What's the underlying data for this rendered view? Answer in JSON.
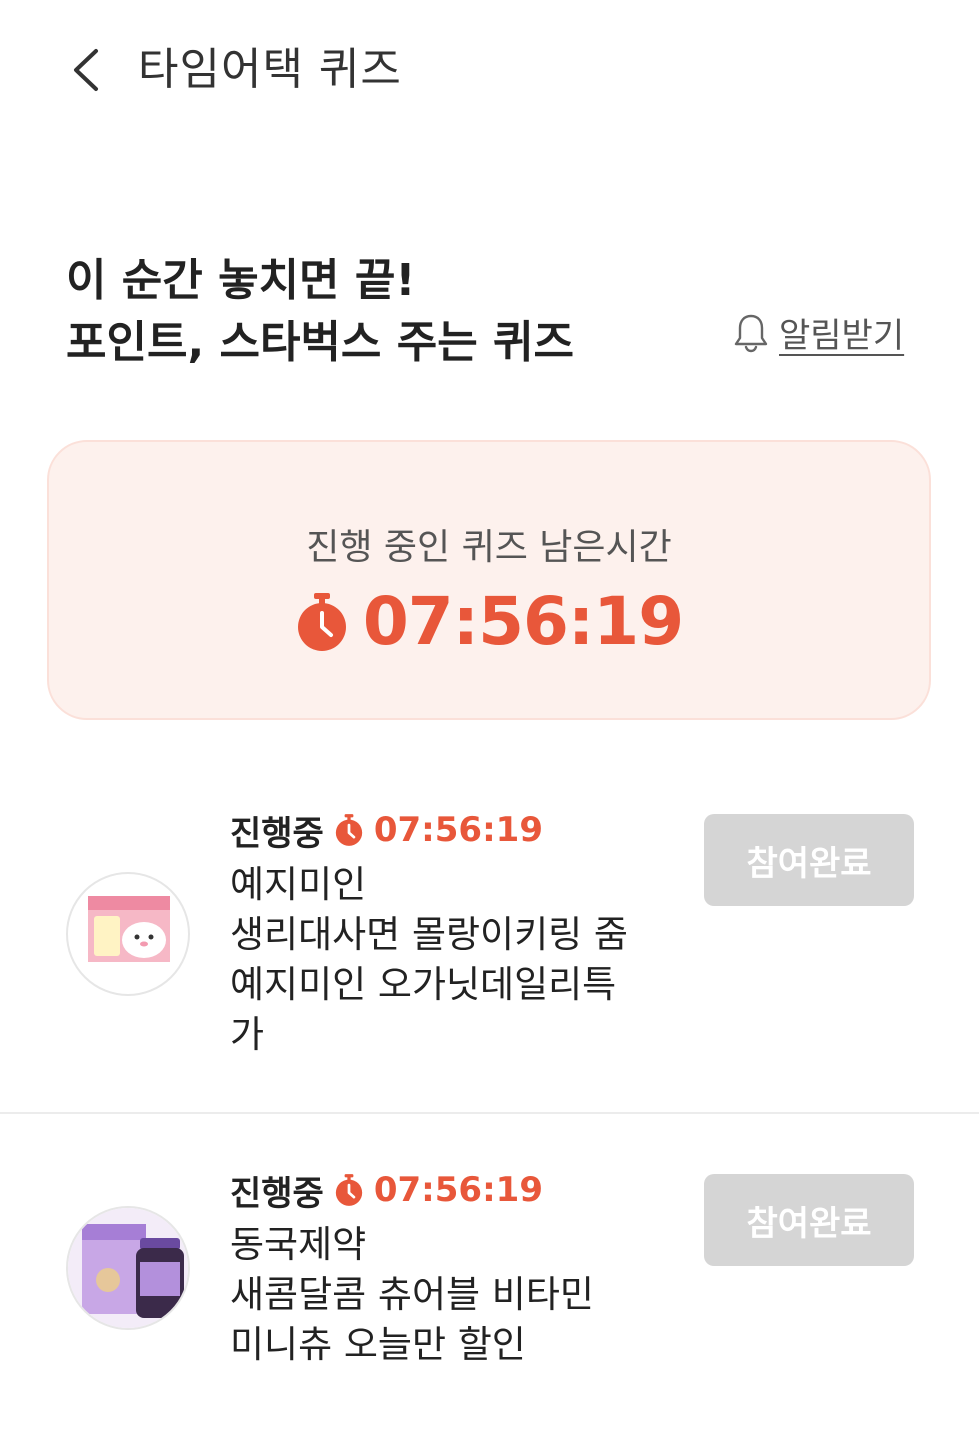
{
  "header": {
    "title": "타임어택 퀴즈",
    "back_icon": "chevron-left-icon"
  },
  "intro": {
    "headline_line1": "이 순간 놓치면 끝!",
    "headline_line2": "포인트, 스타벅스 주는 퀴즈",
    "alarm_label": "알림받기",
    "alarm_icon": "bell-icon"
  },
  "timer_card": {
    "caption": "진행 중인 퀴즈 남은시간",
    "time": "07:56:19",
    "icon": "stopwatch-icon"
  },
  "quiz_items": [
    {
      "status": "진행중",
      "timer": "07:56:19",
      "title_line1": "예지미인",
      "title_line2": "생리대사면 몰랑이키링 줌",
      "title_line3": "예지미인 오가닛데일리특",
      "title_line4": "가",
      "button_label": "참여완료"
    },
    {
      "status": "진행중",
      "timer": "07:56:19",
      "title_line1": "동국제약",
      "title_line2": "새콤달콤 츄어블 비타민",
      "title_line3": "미니츄 오늘만 할인",
      "button_label": "참여완료"
    }
  ],
  "colors": {
    "accent": "#e8573a",
    "card_bg": "#fdf1ed",
    "disabled_btn": "#d5d5d5"
  }
}
